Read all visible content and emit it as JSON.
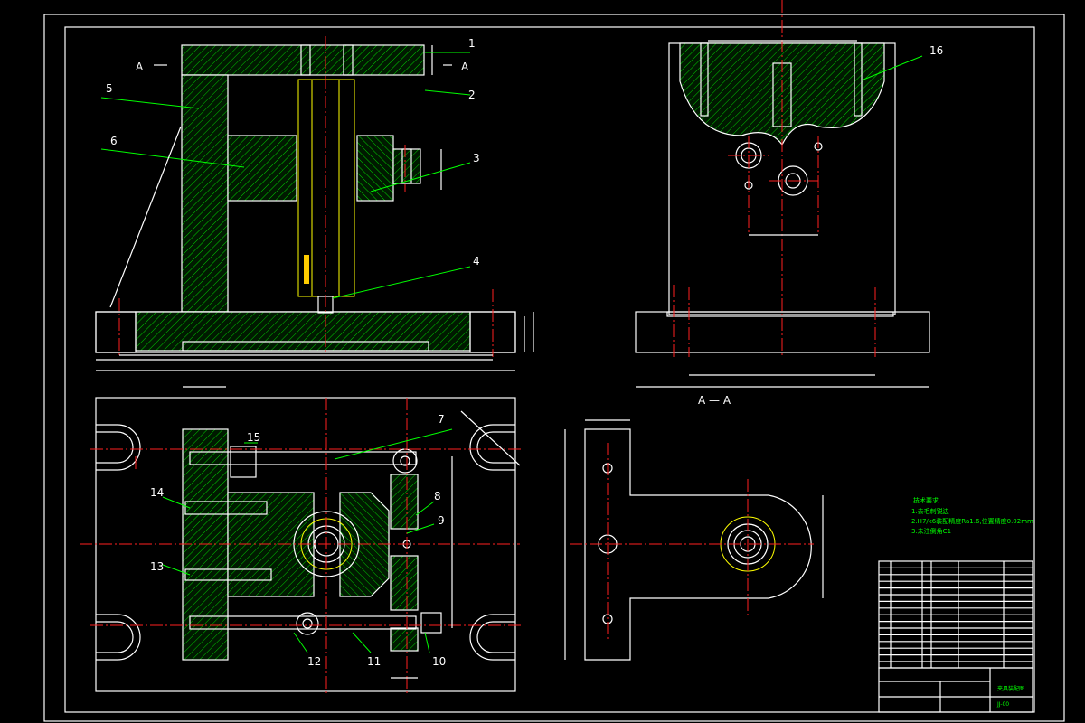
{
  "section_labels": {
    "front_left": "A",
    "front_dash": "—",
    "front_right": "A",
    "side_caption": "A — A"
  },
  "callouts": [
    "1",
    "2",
    "3",
    "4",
    "5",
    "6",
    "7",
    "8",
    "9",
    "10",
    "11",
    "12",
    "13",
    "14",
    "15",
    "16"
  ],
  "tech_notes": {
    "title": "技术要求",
    "lines": [
      "1.去毛刺锐边",
      "2.H7/k6装配精度Ra1.6,位置精度0.02mm",
      "3.未注倒角C1"
    ]
  },
  "title_block": {
    "drawing_name": "夹具装配图",
    "drawing_code": "JJ-00"
  },
  "colors": {
    "outline": "#ffffff",
    "hatch": "#00ff00",
    "centerline": "#ff2020",
    "part": "#ffff00",
    "background": "#000000"
  }
}
